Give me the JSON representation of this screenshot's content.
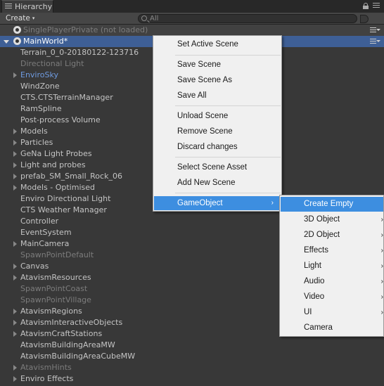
{
  "window": {
    "tab_label": "Hierarchy",
    "create_label": "Create",
    "search_placeholder": "All"
  },
  "scenes": [
    {
      "name": "SinglePlayerPrivate (not loaded)",
      "active": false
    },
    {
      "name": "MainWorld*",
      "active": true
    }
  ],
  "objects": [
    {
      "label": "Terrain_0_0-20180122-123716",
      "foldout": false,
      "dim": false,
      "prefab": false
    },
    {
      "label": "Directional Light",
      "foldout": false,
      "dim": true,
      "prefab": false
    },
    {
      "label": "EnviroSky",
      "foldout": true,
      "dim": false,
      "prefab": true
    },
    {
      "label": "WindZone",
      "foldout": false,
      "dim": false,
      "prefab": false
    },
    {
      "label": "CTS.CTSTerrainManager",
      "foldout": false,
      "dim": false,
      "prefab": false
    },
    {
      "label": "RamSpline",
      "foldout": false,
      "dim": false,
      "prefab": false
    },
    {
      "label": "Post-process Volume",
      "foldout": false,
      "dim": false,
      "prefab": false
    },
    {
      "label": "Models",
      "foldout": true,
      "dim": false,
      "prefab": false
    },
    {
      "label": "Particles",
      "foldout": true,
      "dim": false,
      "prefab": false
    },
    {
      "label": "GeNa Light Probes",
      "foldout": true,
      "dim": false,
      "prefab": false
    },
    {
      "label": "Light and probes",
      "foldout": true,
      "dim": false,
      "prefab": false
    },
    {
      "label": "prefab_SM_Small_Rock_06",
      "foldout": true,
      "dim": false,
      "prefab": false
    },
    {
      "label": "Models - Optimised",
      "foldout": true,
      "dim": false,
      "prefab": false
    },
    {
      "label": "Enviro Directional Light",
      "foldout": false,
      "dim": false,
      "prefab": false
    },
    {
      "label": "CTS Weather Manager",
      "foldout": false,
      "dim": false,
      "prefab": false
    },
    {
      "label": "Controller",
      "foldout": false,
      "dim": false,
      "prefab": false
    },
    {
      "label": "EventSystem",
      "foldout": false,
      "dim": false,
      "prefab": false
    },
    {
      "label": "MainCamera",
      "foldout": true,
      "dim": false,
      "prefab": false
    },
    {
      "label": "SpawnPointDefault",
      "foldout": false,
      "dim": true,
      "prefab": false
    },
    {
      "label": "Canvas",
      "foldout": true,
      "dim": false,
      "prefab": false
    },
    {
      "label": "AtavismResources",
      "foldout": true,
      "dim": false,
      "prefab": false
    },
    {
      "label": "SpawnPointCoast",
      "foldout": false,
      "dim": true,
      "prefab": false
    },
    {
      "label": "SpawnPointVillage",
      "foldout": false,
      "dim": true,
      "prefab": false
    },
    {
      "label": "AtavismRegions",
      "foldout": true,
      "dim": false,
      "prefab": false
    },
    {
      "label": "AtavismInteractiveObjects",
      "foldout": true,
      "dim": false,
      "prefab": false
    },
    {
      "label": "AtavismCraftStations",
      "foldout": true,
      "dim": false,
      "prefab": false
    },
    {
      "label": "AtavismBuildingAreaMW",
      "foldout": false,
      "dim": false,
      "prefab": false
    },
    {
      "label": "AtavismBuildingAreaCubeMW",
      "foldout": false,
      "dim": false,
      "prefab": false
    },
    {
      "label": "AtavismHints",
      "foldout": true,
      "dim": true,
      "prefab": false
    },
    {
      "label": "Enviro Effects",
      "foldout": true,
      "dim": false,
      "prefab": false
    }
  ],
  "context_menu": {
    "items": [
      {
        "label": "Set Active Scene"
      },
      {
        "label": "Save Scene"
      },
      {
        "label": "Save Scene As"
      },
      {
        "label": "Save All"
      },
      {
        "label": "Unload Scene"
      },
      {
        "label": "Remove Scene"
      },
      {
        "label": "Discard changes"
      },
      {
        "label": "Select Scene Asset"
      },
      {
        "label": "Add New Scene"
      },
      {
        "label": "GameObject",
        "highlighted": true,
        "submenu": true
      }
    ]
  },
  "gameobject_submenu": {
    "items": [
      {
        "label": "Create Empty",
        "highlighted": true,
        "submenu": false
      },
      {
        "label": "3D Object",
        "submenu": true
      },
      {
        "label": "2D Object",
        "submenu": true
      },
      {
        "label": "Effects",
        "submenu": true
      },
      {
        "label": "Light",
        "submenu": true
      },
      {
        "label": "Audio",
        "submenu": true
      },
      {
        "label": "Video",
        "submenu": true
      },
      {
        "label": "UI",
        "submenu": true
      },
      {
        "label": "Camera",
        "submenu": false
      }
    ]
  },
  "colors": {
    "panel_bg": "#383838",
    "active_scene_bg": "#3e5f96",
    "menu_bg": "#f0f0f0",
    "menu_highlight": "#3d8ee0",
    "prefab_text": "#6f9be0",
    "dim_text": "#7c7c7c",
    "text": "#c4c4c4"
  },
  "icons": {
    "submenu_arrow": "›",
    "create_arrow": "▾"
  }
}
